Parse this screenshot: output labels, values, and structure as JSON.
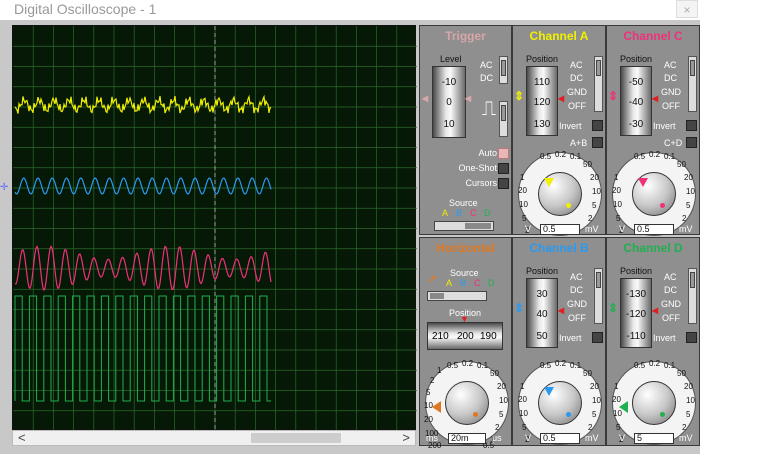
{
  "window": {
    "title": "Digital Oscilloscope - 1",
    "close_glyph": "×"
  },
  "colors": {
    "trigger": "#d8a6a6",
    "channel_a": "#f0f000",
    "channel_b": "#2a9af0",
    "channel_c": "#f0307a",
    "channel_d": "#20b050",
    "horizontal": "#e07820",
    "grid": "#2a6a2a"
  },
  "scroll": {
    "left": "<",
    "right": ">"
  },
  "trigger": {
    "title": "Trigger",
    "level_label": "Level",
    "level_wheel": [
      "-10",
      "0",
      "10"
    ],
    "ac": "AC",
    "dc": "DC",
    "auto": "Auto",
    "one_shot": "One-Shot",
    "cursors": "Cursors",
    "source_label": "Source",
    "source_letters": [
      "A",
      "B",
      "C",
      "D"
    ]
  },
  "channel_a": {
    "title": "Channel A",
    "position_label": "Position",
    "wheel": [
      "110",
      "120",
      "130"
    ],
    "ac": "AC",
    "dc": "DC",
    "gnd": "GND",
    "off": "OFF",
    "invert": "Invert",
    "sum": "A+B",
    "ticks": [
      "0.5",
      "0.2",
      "0.1",
      "50",
      "20",
      "10",
      "5",
      "2",
      "1",
      "20",
      "10",
      "5",
      "2"
    ],
    "unit_left": "V",
    "value": "0.5",
    "unit_right": "mV"
  },
  "channel_c": {
    "title": "Channel C",
    "position_label": "Position",
    "wheel": [
      "-50",
      "-40",
      "-30"
    ],
    "ac": "AC",
    "dc": "DC",
    "gnd": "GND",
    "off": "OFF",
    "invert": "Invert",
    "sum": "C+D",
    "ticks": [
      "0.5",
      "0.2",
      "0.1",
      "50",
      "20",
      "10",
      "5",
      "2",
      "1",
      "20",
      "10",
      "5",
      "2"
    ],
    "unit_left": "V",
    "value": "0.5",
    "unit_right": "mV"
  },
  "horizontal": {
    "title": "Horizontal",
    "source_label": "Source",
    "source_letters": [
      "A",
      "B",
      "C",
      "D"
    ],
    "position_label": "Position",
    "wheel": [
      "210",
      "200",
      "190"
    ],
    "ticks": [
      "0.5",
      "0.2",
      "0.1",
      "50",
      "20",
      "10",
      "5",
      "2",
      "1",
      "0.5",
      "200",
      "100",
      "20",
      "10",
      "5",
      "2",
      "1"
    ],
    "unit_left": "ms",
    "value": "20m",
    "unit_right": "μs"
  },
  "channel_b": {
    "title": "Channel B",
    "position_label": "Position",
    "wheel": [
      "30",
      "40",
      "50"
    ],
    "ac": "AC",
    "dc": "DC",
    "gnd": "GND",
    "off": "OFF",
    "invert": "Invert",
    "ticks": [
      "0.5",
      "0.2",
      "0.1",
      "50",
      "20",
      "10",
      "5",
      "2",
      "1",
      "20",
      "10",
      "5",
      "2"
    ],
    "unit_left": "V",
    "value": "0.5",
    "unit_right": "mV"
  },
  "channel_d": {
    "title": "Channel D",
    "position_label": "Position",
    "wheel": [
      "-130",
      "-120",
      "-110"
    ],
    "ac": "AC",
    "dc": "DC",
    "gnd": "GND",
    "off": "OFF",
    "invert": "Invert",
    "ticks": [
      "0.5",
      "0.2",
      "0.1",
      "50",
      "20",
      "10",
      "5",
      "2",
      "1",
      "20",
      "10",
      "5",
      "2"
    ],
    "unit_left": "V",
    "value": "5",
    "unit_right": "mV"
  }
}
